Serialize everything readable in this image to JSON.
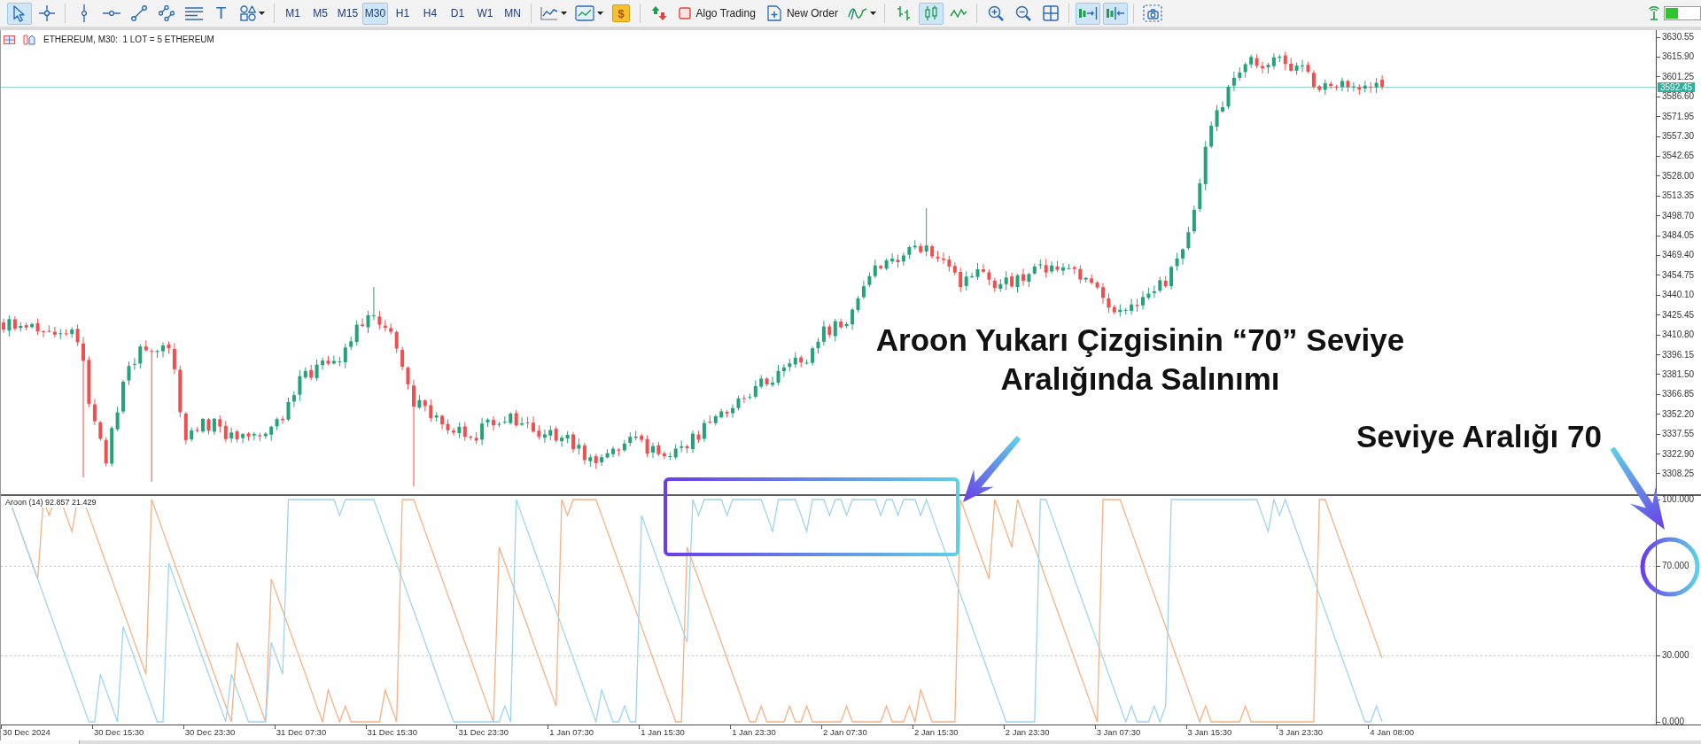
{
  "toolbar": {
    "tools": [
      {
        "selected": true
      },
      {
        "selected": false
      },
      {
        "selected": false
      },
      {
        "selected": false
      },
      {
        "selected": false
      },
      {
        "selected": false
      },
      {
        "selected": false
      },
      {
        "label": "T",
        "selected": false
      },
      {
        "selected": false
      }
    ],
    "timeframes": [
      {
        "label": "M1",
        "selected": false
      },
      {
        "label": "M5",
        "selected": false
      },
      {
        "label": "M15",
        "selected": false
      },
      {
        "label": "M30",
        "selected": true
      },
      {
        "label": "H1",
        "selected": false
      },
      {
        "label": "H4",
        "selected": false
      },
      {
        "label": "D1",
        "selected": false
      },
      {
        "label": "W1",
        "selected": false
      },
      {
        "label": "MN",
        "selected": false
      }
    ],
    "market_button": {
      "label": "$"
    },
    "algo_trading": {
      "label": "Algo Trading"
    },
    "new_order": {
      "label": "New Order"
    },
    "chart_types": [
      {
        "selected": false
      },
      {
        "selected": true
      },
      {
        "selected": false
      }
    ],
    "scroll_modes": [
      {
        "selected": true
      },
      {
        "selected": true
      }
    ]
  },
  "chart": {
    "title": "ETHEREUM, M30:  1 LOT = 5 ETHEREUM",
    "current_price": "3592.45",
    "price_axis": [
      "3630.55",
      "3615.90",
      "3601.25",
      "3586.60",
      "3571.95",
      "3557.30",
      "3542.65",
      "3528.00",
      "3513.35",
      "3498.70",
      "3484.05",
      "3469.40",
      "3454.75",
      "3440.10",
      "3425.45",
      "3410.80",
      "3396.15",
      "3381.50",
      "3366.85",
      "3352.20",
      "3337.55",
      "3322.90",
      "3308.25"
    ],
    "indicator": {
      "label": "Aroon (14) 92.857 21.429",
      "axis": [
        "100.000",
        "70.000",
        "30.000",
        "0.000"
      ]
    },
    "time_axis": [
      "30 Dec 2024",
      "30 Dec 15:30",
      "30 Dec 23:30",
      "31 Dec 07:30",
      "31 Dec 15:30",
      "31 Dec 23:30",
      "1 Jan 07:30",
      "1 Jan 15:30",
      "1 Jan 23:30",
      "2 Jan 07:30",
      "2 Jan 15:30",
      "2 Jan 23:30",
      "3 Jan 07:30",
      "3 Jan 15:30",
      "3 Jan 23:30",
      "4 Jan 08:00"
    ]
  },
  "annotations": [
    {
      "kind": "box_callout",
      "text": "Aroon Yukarı Çizgisinin “70” Seviye Aralığında Salınımı"
    },
    {
      "kind": "circle_callout",
      "text": "Seviye Aralığı 70"
    }
  ]
}
